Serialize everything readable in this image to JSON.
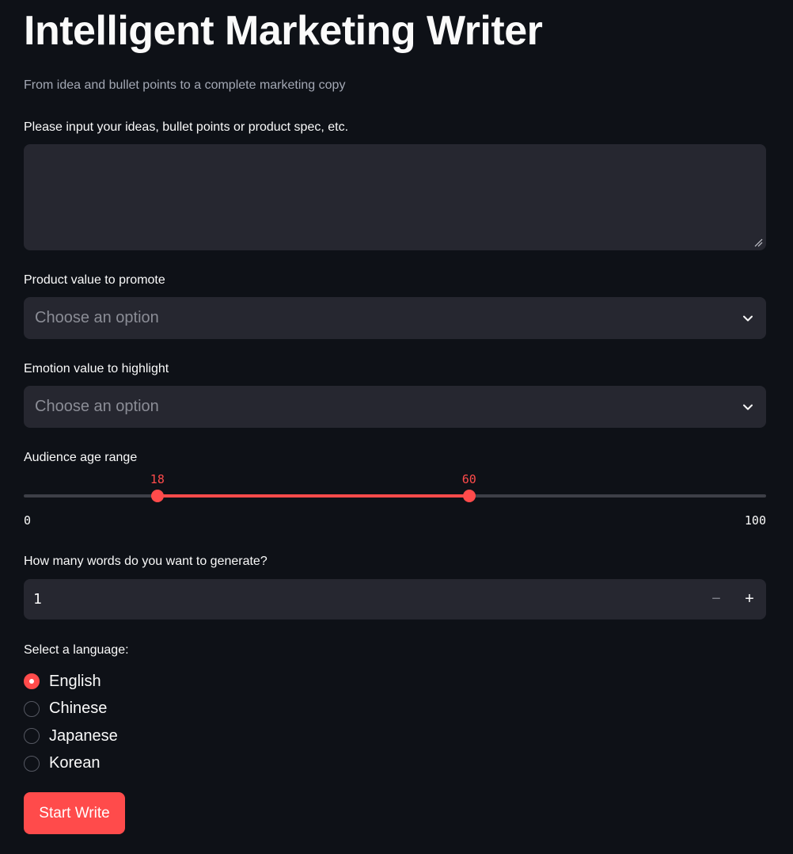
{
  "header": {
    "title": "Intelligent Marketing Writer",
    "subtitle": "From idea and bullet points to a complete marketing copy"
  },
  "ideas": {
    "label": "Please input your ideas, bullet points or product spec, etc.",
    "value": ""
  },
  "product_value": {
    "label": "Product value to promote",
    "placeholder": "Choose an option",
    "icon": "chevron-down-icon"
  },
  "emotion_value": {
    "label": "Emotion value to highlight",
    "placeholder": "Choose an option",
    "icon": "chevron-down-icon"
  },
  "age_range": {
    "label": "Audience age range",
    "min": 0,
    "max": 100,
    "low": 18,
    "high": 60,
    "min_label": "0",
    "max_label": "100",
    "low_label": "18",
    "high_label": "60"
  },
  "word_count": {
    "label": "How many words do you want to generate?",
    "value": "1",
    "minus_label": "−",
    "plus_label": "+"
  },
  "language": {
    "label": "Select a language:",
    "options": [
      "English",
      "Chinese",
      "Japanese",
      "Korean"
    ],
    "selected": "English"
  },
  "actions": {
    "start_label": "Start Write"
  },
  "colors": {
    "background": "#0e1117",
    "input_bg": "#262730",
    "accent": "#ff4b4b",
    "text": "#fafafa",
    "muted": "#a3a8b4"
  }
}
